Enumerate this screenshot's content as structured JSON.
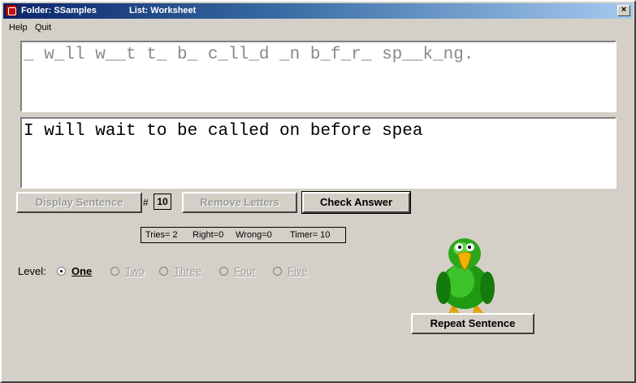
{
  "titlebar": {
    "folder": "Folder: SSamples",
    "list": "List: Worksheet",
    "close": "×"
  },
  "menu": [
    "Help",
    "Quit"
  ],
  "puzzle_text": "_ w_ll w__t t_ b_ c_ll_d _n b_f_r_ sp__k_ng.",
  "answer_text": "I will wait to be called on before spea",
  "controls": {
    "display_sentence": "Display Sentence",
    "number_sign": "#",
    "number_value": "10",
    "remove_letters": "Remove Letters",
    "check_answer": "Check Answer",
    "repeat_sentence": "Repeat Sentence"
  },
  "stats": {
    "tries": "Tries= 2",
    "right": "Right=0",
    "wrong": "Wrong=0",
    "timer": "Timer=  10"
  },
  "level": {
    "label": "Level:",
    "options": [
      {
        "label": "One",
        "selected": true,
        "enabled": true
      },
      {
        "label": "Two",
        "selected": false,
        "enabled": false
      },
      {
        "label": "Three",
        "selected": false,
        "enabled": false
      },
      {
        "label": "Four",
        "selected": false,
        "enabled": false
      },
      {
        "label": "Five",
        "selected": false,
        "enabled": false
      }
    ]
  },
  "colors": {
    "puzzle_text": "#8a8a8a",
    "parrot_green": "#2aa81a",
    "beak": "#f0b400"
  },
  "icons": {
    "app": "app-icon",
    "mascot": "parrot-icon"
  }
}
